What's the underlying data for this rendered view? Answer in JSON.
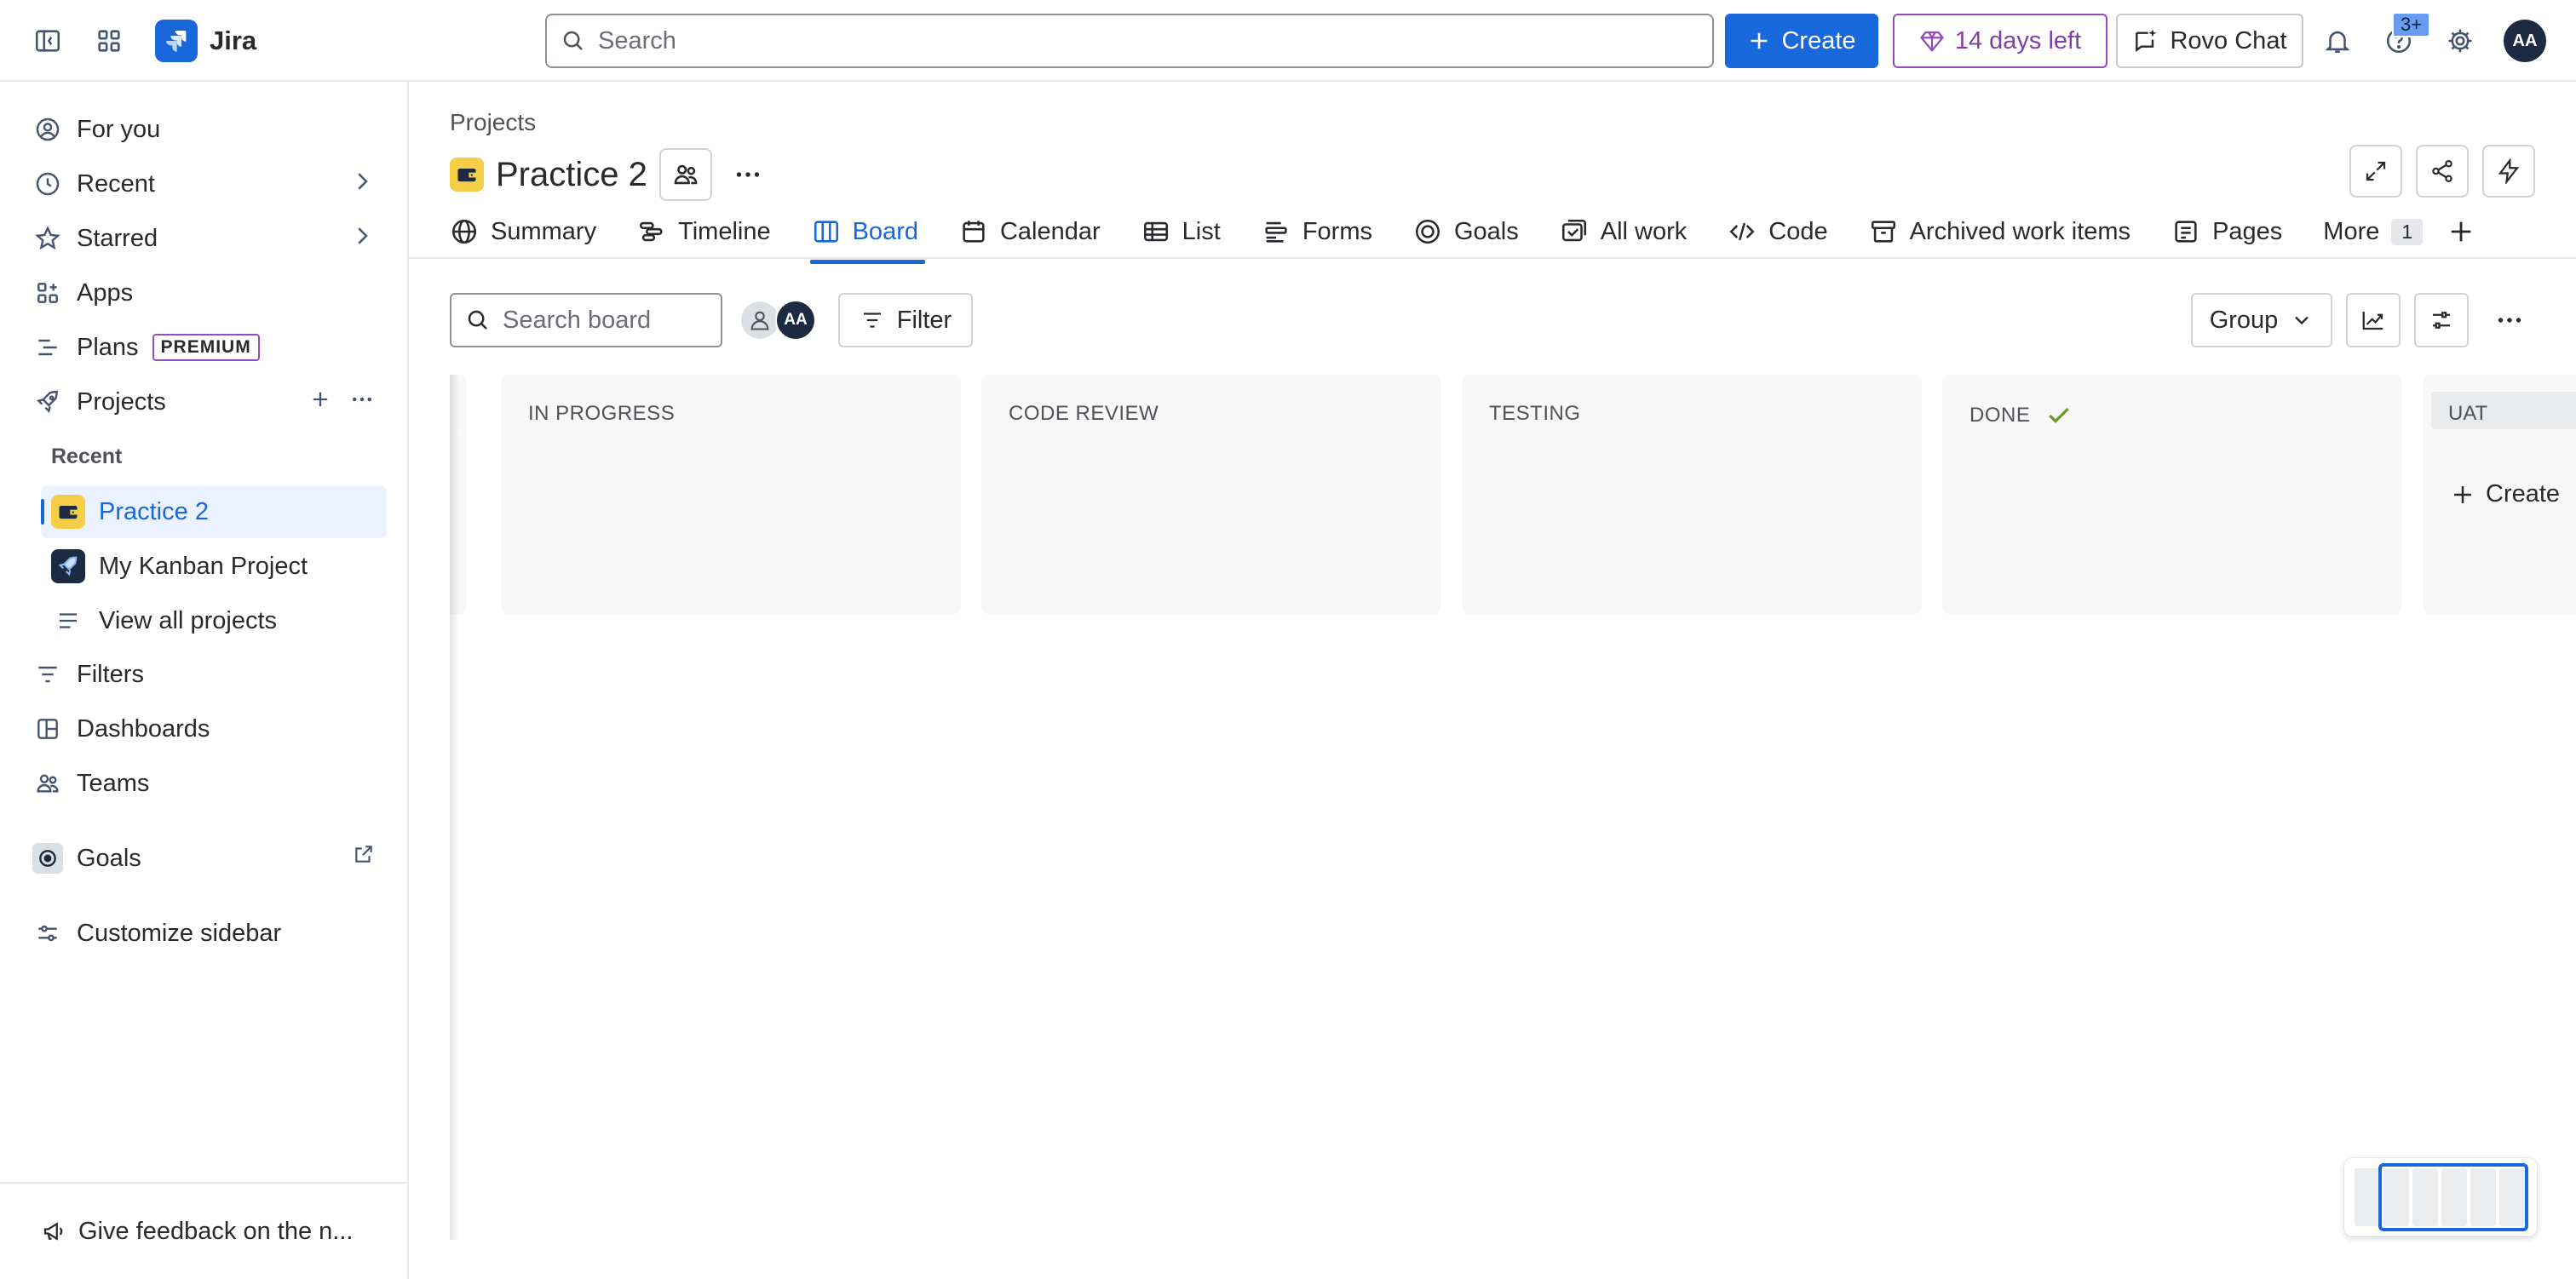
{
  "app": {
    "name": "Jira"
  },
  "topbar": {
    "search_placeholder": "Search",
    "create_label": "Create",
    "trial_label": "14 days left",
    "rovo_label": "Rovo Chat",
    "help_badge": "3+",
    "avatar_initials": "AA"
  },
  "sidebar": {
    "items": {
      "for_you": "For you",
      "recent": "Recent",
      "starred": "Starred",
      "apps": "Apps",
      "plans": "Plans",
      "plans_badge": "PREMIUM",
      "projects": "Projects",
      "filters": "Filters",
      "dashboards": "Dashboards",
      "teams": "Teams",
      "goals": "Goals",
      "customize": "Customize sidebar"
    },
    "recent_label": "Recent",
    "projects": [
      {
        "name": "Practice 2",
        "selected": true
      },
      {
        "name": "My Kanban Project",
        "selected": false
      }
    ],
    "view_all": "View all projects",
    "feedback": "Give feedback on the n..."
  },
  "main": {
    "breadcrumb": "Projects",
    "project_title": "Practice 2",
    "tabs": [
      {
        "label": "Summary",
        "icon": "globe-icon"
      },
      {
        "label": "Timeline",
        "icon": "timeline-icon"
      },
      {
        "label": "Board",
        "icon": "board-icon",
        "active": true
      },
      {
        "label": "Calendar",
        "icon": "calendar-icon"
      },
      {
        "label": "List",
        "icon": "list-icon"
      },
      {
        "label": "Forms",
        "icon": "forms-icon"
      },
      {
        "label": "Goals",
        "icon": "goals-icon"
      },
      {
        "label": "All work",
        "icon": "all-work-icon"
      },
      {
        "label": "Code",
        "icon": "code-icon"
      },
      {
        "label": "Archived work items",
        "icon": "archive-icon"
      },
      {
        "label": "Pages",
        "icon": "pages-icon"
      }
    ],
    "more_tab": {
      "label": "More",
      "count": "1"
    },
    "board_search_placeholder": "Search board",
    "avatar_initials": "AA",
    "filter_label": "Filter",
    "group_label": "Group",
    "columns": [
      {
        "title": "IN PROGRESS"
      },
      {
        "title": "CODE REVIEW"
      },
      {
        "title": "TESTING"
      },
      {
        "title": "DONE",
        "done": true
      }
    ],
    "uat_column": {
      "title": "UAT",
      "create_label": "Create"
    }
  },
  "colors": {
    "brand_blue": "#1868db",
    "trial_purple": "#964ac0",
    "column_bg": "#f8f8f8",
    "done_check": "#6a9a23"
  }
}
